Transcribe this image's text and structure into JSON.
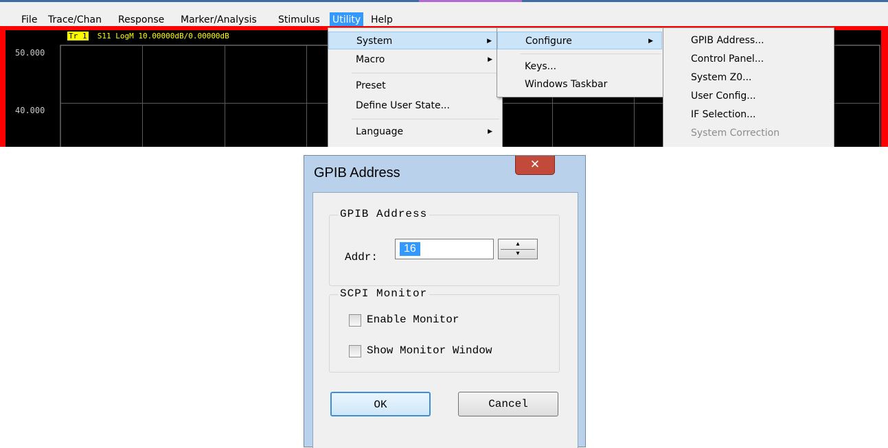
{
  "menubar": {
    "items": [
      "File",
      "Trace/Chan",
      "Response",
      "Marker/Analysis",
      "Stimulus",
      "Utility",
      "Help"
    ],
    "active": "Utility"
  },
  "chart": {
    "trace_tag": "Tr 1",
    "trace_text": "S11 LogM 10.00000dB/0.00000dB",
    "y_labels": [
      "50.000",
      "40.000"
    ],
    "colors": {
      "frame": "#ff0000",
      "background": "#000000",
      "grid": "#5a5a5a",
      "trace_label": "#ffff00"
    }
  },
  "utility_menu": {
    "items": [
      {
        "label": "System",
        "submenu": true,
        "highlighted": true
      },
      {
        "label": "Macro",
        "submenu": true
      },
      {
        "label": "Preset"
      },
      {
        "label": "Define User State..."
      },
      {
        "label": "Language",
        "submenu": true
      }
    ]
  },
  "system_menu": {
    "items": [
      {
        "label": "Configure",
        "submenu": true,
        "highlighted": true
      },
      {
        "label": "Keys..."
      },
      {
        "label": "Windows Taskbar"
      }
    ]
  },
  "configure_menu": {
    "items": [
      {
        "label": "GPIB Address..."
      },
      {
        "label": "Control Panel..."
      },
      {
        "label": "System Z0..."
      },
      {
        "label": "User Config..."
      },
      {
        "label": "IF Selection..."
      },
      {
        "label": "System Correction",
        "disabled": true
      }
    ]
  },
  "dialog": {
    "title": "GPIB Address",
    "close_icon": "x-close-icon",
    "gpib_group": {
      "title": "GPIB Address",
      "addr_label": "Addr:",
      "addr_value": "16"
    },
    "scpi_group": {
      "title": "SCPI Monitor",
      "enable_monitor": {
        "label": "Enable Monitor",
        "checked": false
      },
      "show_monitor_window": {
        "label": "Show Monitor Window",
        "checked": false
      }
    },
    "ok_label": "OK",
    "cancel_label": "Cancel"
  }
}
